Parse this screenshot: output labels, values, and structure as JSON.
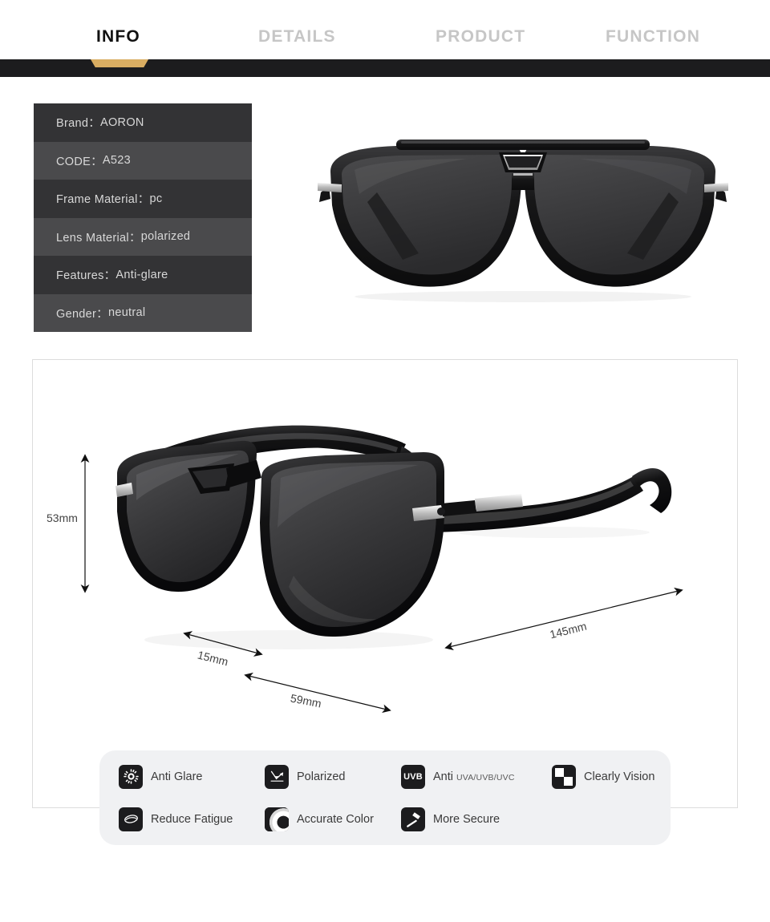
{
  "tabs": [
    {
      "label": "INFO",
      "active": true
    },
    {
      "label": "DETAILS",
      "active": false
    },
    {
      "label": "PRODUCT",
      "active": false
    },
    {
      "label": "FUNCTION",
      "active": false
    }
  ],
  "spec_table": [
    {
      "label": "Brand：",
      "value": "AORON"
    },
    {
      "label": "CODE：",
      "value": "A523"
    },
    {
      "label": "Frame Material：",
      "value": "pc"
    },
    {
      "label": "Lens Material：",
      "value": "polarized"
    },
    {
      "label": "Features：",
      "value": "Anti-glare"
    },
    {
      "label": "Gender：",
      "value": "neutral"
    }
  ],
  "dimensions": {
    "height": "53mm",
    "bridge": "15mm",
    "lens_width": "59mm",
    "temple_length": "145mm"
  },
  "features": [
    {
      "label": "Anti Glare",
      "icon": "sun-icon"
    },
    {
      "label": "Polarized",
      "icon": "reflection-arrow-icon"
    },
    {
      "label": "Anti ",
      "sub": "UVA/UVB/UVC",
      "icon": "uvb-badge-icon",
      "badge": "UVB"
    },
    {
      "label": "Clearly Vision",
      "icon": "checkerboard-icon"
    },
    {
      "label": "Reduce Fatigue",
      "icon": "eye-icon"
    },
    {
      "label": "Accurate Color",
      "icon": "color-swirl-icon"
    },
    {
      "label": "More Secure",
      "icon": "hammer-icon"
    }
  ],
  "colors": {
    "accent_gold": "#d9ad62",
    "dark_band": "#1c1c1e",
    "row_odd": "#333335",
    "row_even": "#4a4a4c",
    "feature_panel_bg": "#f0f1f3"
  }
}
